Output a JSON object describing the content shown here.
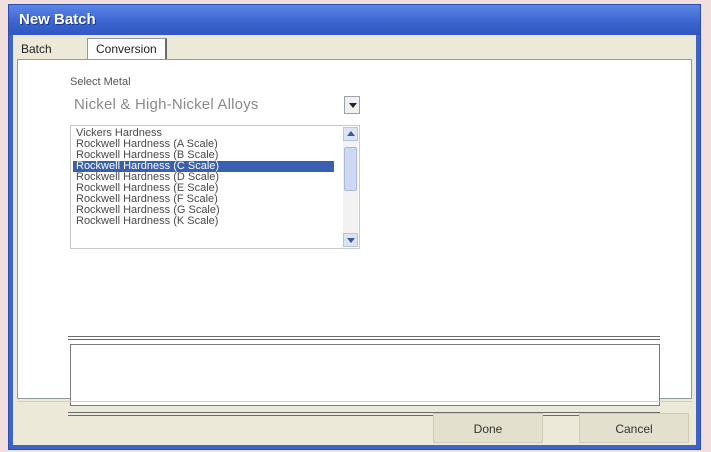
{
  "window": {
    "title": "New Batch"
  },
  "tabs": [
    {
      "label": "Batch"
    },
    {
      "label": "Conversion"
    }
  ],
  "conversion": {
    "select_metal_label": "Select Metal",
    "metal_value": "Nickel & High-Nickel Alloys",
    "hardness_options": [
      "Vickers Hardness",
      "Rockwell Hardness (A Scale)",
      "Rockwell Hardness (B Scale)",
      "Rockwell Hardness (C Scale)",
      "Rockwell Hardness (D Scale)",
      "Rockwell Hardness (E Scale)",
      "Rockwell Hardness (F Scale)",
      "Rockwell Hardness (G Scale)",
      "Rockwell Hardness (K Scale)"
    ],
    "selected_option": "Rockwell Hardness (C Scale)",
    "result_text": ""
  },
  "buttons": {
    "done": "Done",
    "cancel": "Cancel"
  },
  "colors": {
    "titlebar": "#3f64c9",
    "selection": "#3a5fb0",
    "dialog_face": "#ece9d8"
  }
}
